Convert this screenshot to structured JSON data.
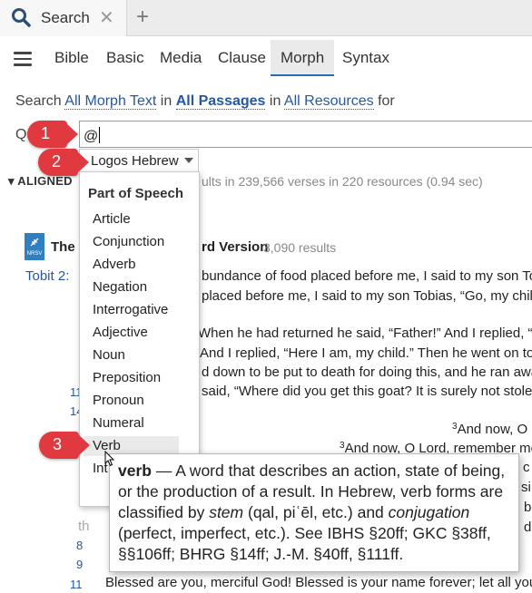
{
  "tab": {
    "title": "Search",
    "close": "✕",
    "new": "+"
  },
  "modes": [
    "Bible",
    "Basic",
    "Media",
    "Clause",
    "Morph",
    "Syntax"
  ],
  "search_line": {
    "prefix": "Search",
    "scope_text": "All Morph Text",
    "in1": "in",
    "passages": "All Passages",
    "in2": "in",
    "resources": "All Resources",
    "suffix": "for"
  },
  "query": {
    "label": "Q",
    "value": "@"
  },
  "language": "Logos Hebrew",
  "results": {
    "aligned": "ALIGNED",
    "summary": "ults in 239,566 verses in 220 resources (0.94 sec)",
    "resource_title_a": "The N",
    "resource_title_b": "rd Version",
    "resource_count": "3,090 results",
    "logo_text": "NRSV",
    "reference": "Tobit 2:",
    "lines": [
      "bundance of food placed before me, I said to my son Tobi",
      "placed before me, I said to my son Tobias, “Go, my child,",
      "When he had returned he said, “Father!” And I replied, “H",
      "And I replied, “Here I am, my child.” Then he went on to s",
      "d down to be put to death for doing this, and he ran away",
      "said, “Where did you get this goat? It is surely not stolen,",
      "And now, O L",
      "And now, O Lord, remember me",
      "Blessed are you, merciful God! Blessed is your name forever; let all your"
    ],
    "verse_numbers": [
      "11",
      "14",
      "8",
      "9",
      "11"
    ],
    "sup3a": "3",
    "sup3b": "3",
    "right_edge": [
      "c",
      "si",
      "b",
      "d"
    ],
    "partial_th": "th"
  },
  "dropdown": {
    "heading": "Part of Speech",
    "items": [
      "Article",
      "Conjunction",
      "Adverb",
      "Negation",
      "Interrogative",
      "Adjective",
      "Noun",
      "Preposition",
      "Pronoun",
      "Numeral",
      "Verb",
      "Int"
    ]
  },
  "tooltip": {
    "term": "verb",
    "dash": " — ",
    "t1": "A word that describes an action, state of being, or the production of a result. In Hebrew, verb forms are classified by ",
    "stem": "stem",
    "t2": " (qal, piʿēl, etc.) and ",
    "conj": "conjugation",
    "t3": " (perfect, imperfect, etc.). See IBHS §20ff; GKC §38ff, §§106ff; BHRG §14ff; J.-M. §40ff, §111ff."
  },
  "callouts": [
    "1",
    "2",
    "3"
  ],
  "colors": {
    "accent": "#2258a6",
    "callout": "#e0393f"
  }
}
